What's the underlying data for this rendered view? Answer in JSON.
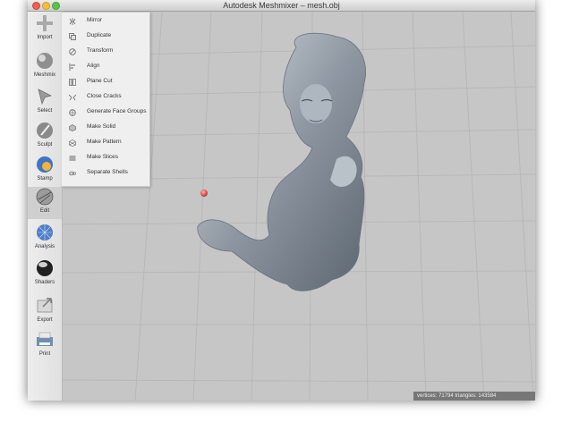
{
  "window": {
    "title": "Autodesk Meshmixer – mesh.obj"
  },
  "toolbar": {
    "items": [
      {
        "label": "Import",
        "icon": "plus-icon"
      },
      {
        "label": "Meshmix",
        "icon": "meshmix-sphere-icon"
      },
      {
        "label": "Select",
        "icon": "select-arrow-icon"
      },
      {
        "label": "Sculpt",
        "icon": "sculpt-brush-icon"
      },
      {
        "label": "Stamp",
        "icon": "stamp-icon"
      },
      {
        "label": "Edit",
        "icon": "edit-icon"
      },
      {
        "label": "Analysis",
        "icon": "analysis-icon"
      },
      {
        "label": "Shaders",
        "icon": "shaders-sphere-icon"
      },
      {
        "label": "Export",
        "icon": "export-icon"
      },
      {
        "label": "Print",
        "icon": "print-icon"
      }
    ],
    "active": "Edit"
  },
  "edit_menu": {
    "items": [
      {
        "label": "Mirror",
        "icon": "mirror-icon"
      },
      {
        "label": "Duplicate",
        "icon": "duplicate-icon"
      },
      {
        "label": "Transform",
        "icon": "transform-icon"
      },
      {
        "label": "Align",
        "icon": "align-icon"
      },
      {
        "label": "Plane Cut",
        "icon": "plane-cut-icon"
      },
      {
        "label": "Close Cracks",
        "icon": "close-cracks-icon"
      },
      {
        "label": "Generate Face Groups",
        "icon": "face-groups-icon"
      },
      {
        "label": "Make Solid",
        "icon": "make-solid-icon"
      },
      {
        "label": "Make Pattern",
        "icon": "make-pattern-icon"
      },
      {
        "label": "Make Slices",
        "icon": "make-slices-icon"
      },
      {
        "label": "Separate Shells",
        "icon": "separate-shells-icon"
      }
    ]
  },
  "status": {
    "text": "vertices: 71794 triangles: 143584"
  },
  "colors": {
    "viewport": "#c6c6c6",
    "grid": "#b7b7b7",
    "pivot": "#e03a3a",
    "mesh": "#9aa3ad"
  }
}
